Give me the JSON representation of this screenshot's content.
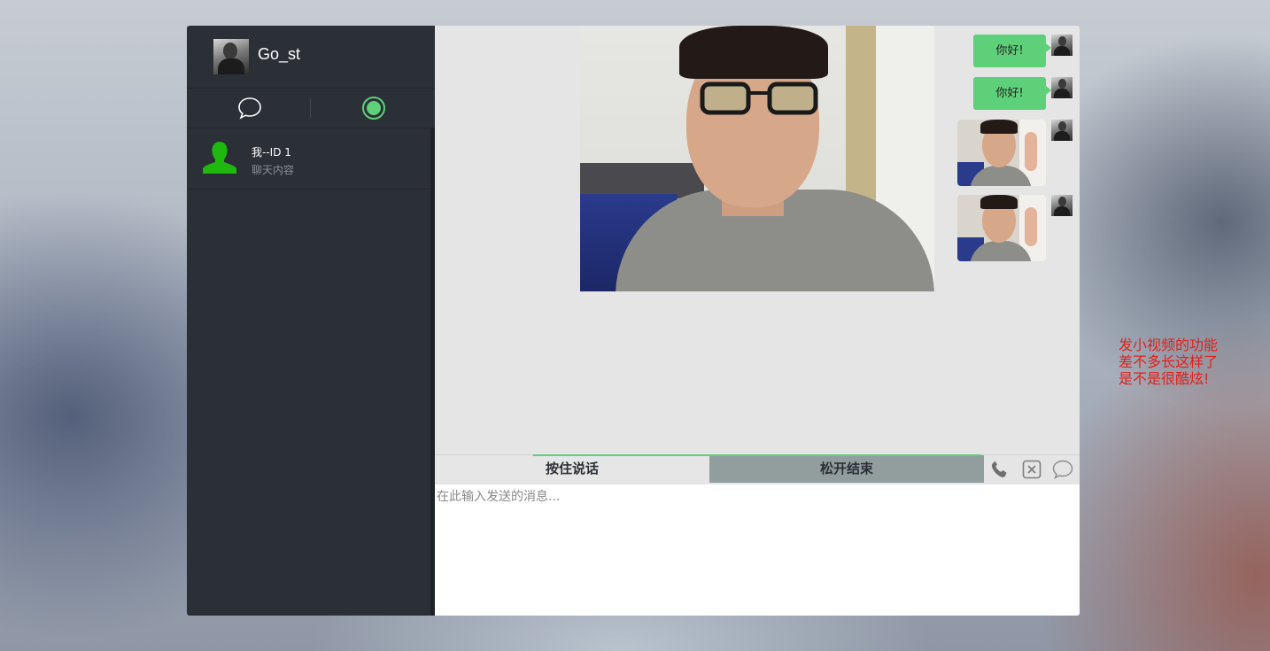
{
  "user": {
    "name": "Go_st",
    "avatar_icon": "user-photo-avatar"
  },
  "nav_tabs": [
    {
      "icon": "chat-bubble-icon",
      "active": false
    },
    {
      "icon": "record-icon",
      "active": true
    }
  ],
  "contacts": [
    {
      "name": "我--ID 1",
      "preview": "聊天内容",
      "avatar_icon": "silhouette-avatar-icon"
    }
  ],
  "messages": [
    {
      "type": "text",
      "text": "你好!",
      "sender": "self"
    },
    {
      "type": "text",
      "text": "你好!",
      "sender": "self"
    },
    {
      "type": "video",
      "sender": "self"
    },
    {
      "type": "video",
      "sender": "self"
    }
  ],
  "toolbar": {
    "hold_to_talk_label": "按住说话",
    "release_to_end_label": "松开结束",
    "icons": [
      "phone-icon",
      "close-box-icon",
      "chat-bubble-icon"
    ]
  },
  "composer": {
    "placeholder": "在此输入发送的消息..."
  },
  "annotation": {
    "lines": [
      "发小视频的功能",
      "差不多长这样了",
      "是不是很酷炫!"
    ]
  },
  "colors": {
    "sidebar_bg": "#2b2f36",
    "accent_green": "#5fd07a",
    "annotation_red": "#e0201c",
    "release_button_bg": "#929e9e"
  }
}
